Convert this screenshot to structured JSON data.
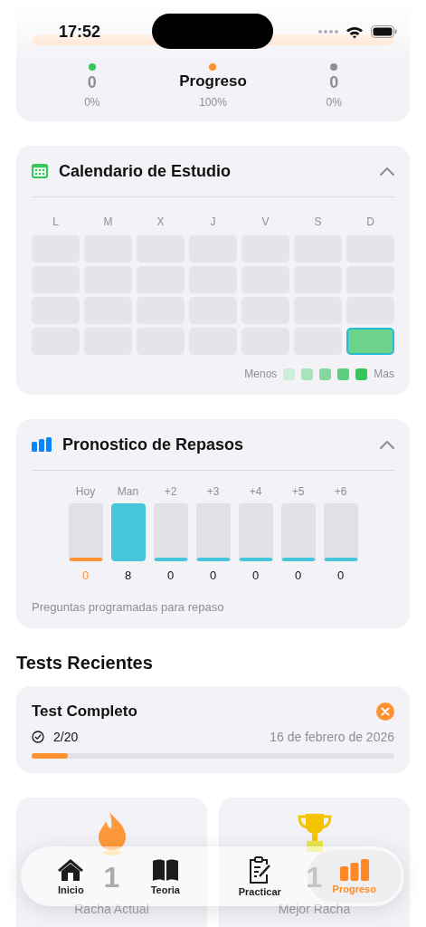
{
  "status_bar": {
    "time": "17:52"
  },
  "header": {
    "title": "Progreso"
  },
  "summary": {
    "progress": {
      "level": 1
    },
    "stats": [
      {
        "color": "#34c759",
        "value": "0",
        "percent": "0%"
      },
      {
        "color": "#ff9230",
        "percent": "100%"
      },
      {
        "color": "#8e8e93",
        "value": "0",
        "percent": "0%"
      }
    ]
  },
  "calendar": {
    "title": "Calendario de Estudio",
    "expanded": true,
    "weekdays": [
      "L",
      "M",
      "X",
      "J",
      "V",
      "S",
      "D"
    ],
    "cells": [
      {
        "color": "#e4e4ea",
        "today": false
      },
      {
        "color": "#e4e4ea",
        "today": false
      },
      {
        "color": "#e4e4ea",
        "today": false
      },
      {
        "color": "#e4e4ea",
        "today": false
      },
      {
        "color": "#e4e4ea",
        "today": false
      },
      {
        "color": "#e4e4ea",
        "today": false
      },
      {
        "color": "#e4e4ea",
        "today": false
      },
      {
        "color": "#e4e4ea",
        "today": false
      },
      {
        "color": "#e4e4ea",
        "today": false
      },
      {
        "color": "#e4e4ea",
        "today": false
      },
      {
        "color": "#e4e4ea",
        "today": false
      },
      {
        "color": "#e4e4ea",
        "today": false
      },
      {
        "color": "#e4e4ea",
        "today": false
      },
      {
        "color": "#e4e4ea",
        "today": false
      },
      {
        "color": "#e4e4ea",
        "today": false
      },
      {
        "color": "#e4e4ea",
        "today": false
      },
      {
        "color": "#e4e4ea",
        "today": false
      },
      {
        "color": "#e4e4ea",
        "today": false
      },
      {
        "color": "#e4e4ea",
        "today": false
      },
      {
        "color": "#e4e4ea",
        "today": false
      },
      {
        "color": "#e4e4ea",
        "today": false
      },
      {
        "color": "#e4e4ea",
        "today": false
      },
      {
        "color": "#e4e4ea",
        "today": false
      },
      {
        "color": "#e4e4ea",
        "today": false
      },
      {
        "color": "#e4e4ea",
        "today": false
      },
      {
        "color": "#e4e4ea",
        "today": false
      },
      {
        "color": "#e4e4ea",
        "today": false
      },
      {
        "color": "#6dd38a",
        "today": true
      }
    ],
    "legend": {
      "less": "Menos",
      "more": "Mas",
      "swatches": [
        {
          "color": "#cbeed7"
        },
        {
          "color": "#a8e4bb"
        },
        {
          "color": "#83d99d"
        },
        {
          "color": "#5dcd7e"
        },
        {
          "color": "#34c759"
        }
      ]
    }
  },
  "forecast": {
    "title": "Pronostico de Repasos",
    "expanded": true,
    "days": [
      {
        "label": "Hoy",
        "count": "0",
        "level": 0,
        "today": true
      },
      {
        "label": "Man",
        "count": "8",
        "level": 1,
        "today": false
      },
      {
        "label": "+2",
        "count": "0",
        "level": 0,
        "today": false
      },
      {
        "label": "+3",
        "count": "0",
        "level": 0,
        "today": false
      },
      {
        "label": "+4",
        "count": "0",
        "level": 0,
        "today": false
      },
      {
        "label": "+5",
        "count": "0",
        "level": 0,
        "today": false
      },
      {
        "label": "+6",
        "count": "0",
        "level": 0,
        "today": false
      }
    ],
    "note": "Preguntas programadas para repaso"
  },
  "recent_tests": {
    "title": "Tests Recientes",
    "items": [
      {
        "name": "Test Completo",
        "passed": false,
        "score": "2/20",
        "date": "16 de febrero de 2026",
        "level": 0.1
      }
    ]
  },
  "streaks": [
    {
      "kind": "flame",
      "value": "1",
      "label": "Racha Actual"
    },
    {
      "kind": "trophy",
      "value": "1",
      "label": "Mejor Racha"
    }
  ],
  "tabs": [
    {
      "label": "Inicio",
      "selected": false
    },
    {
      "label": "Teoria",
      "selected": false
    },
    {
      "label": "Practicar",
      "selected": false
    },
    {
      "label": "Progreso",
      "selected": true
    }
  ]
}
